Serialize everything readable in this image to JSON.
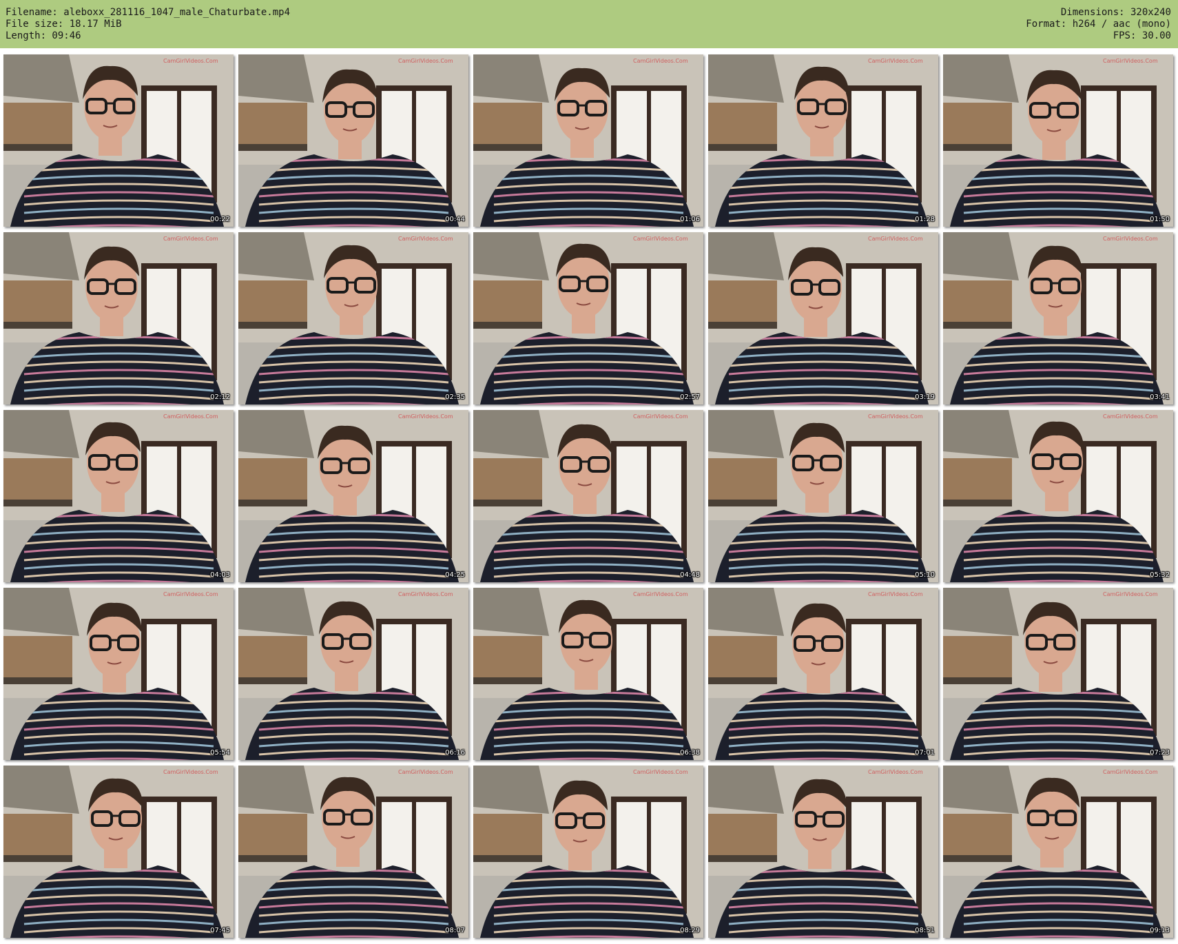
{
  "header": {
    "filename": "Filename: aleboxx_281116_1047_male_Chaturbate.mp4",
    "filesize": "File size: 18.17 MiB",
    "length": "Length: 09:46",
    "dimensions": "Dimensions: 320x240",
    "format": "Format: h264 / aac (mono)",
    "fps": "FPS: 30.00"
  },
  "thumbnails": [
    {
      "time": "00:22"
    },
    {
      "time": "00:44"
    },
    {
      "time": "01:06"
    },
    {
      "time": "01:28"
    },
    {
      "time": "01:50"
    },
    {
      "time": "02:12"
    },
    {
      "time": "02:35"
    },
    {
      "time": "02:57"
    },
    {
      "time": "03:19"
    },
    {
      "time": "03:41"
    },
    {
      "time": "04:03"
    },
    {
      "time": "04:25"
    },
    {
      "time": "04:48"
    },
    {
      "time": "05:10"
    },
    {
      "time": "05:32"
    },
    {
      "time": "05:54"
    },
    {
      "time": "06:16"
    },
    {
      "time": "06:38"
    },
    {
      "time": "07:01"
    },
    {
      "time": "07:23"
    },
    {
      "time": "07:45"
    },
    {
      "time": "08:07"
    },
    {
      "time": "08:29"
    },
    {
      "time": "08:51"
    },
    {
      "time": "09:13"
    }
  ],
  "colors": {
    "header_bg": "#aecb80",
    "wall": "#c9c3b8",
    "window": "#f3f1ec",
    "cabinet": "#9a7a5a",
    "shirt_dark": "#1c1f2b",
    "stripe_pink": "#c77a9a",
    "stripe_beige": "#d8c3a8",
    "stripe_blue": "#8fb0c4",
    "skin": "#d9a890",
    "hair": "#3a2a20"
  }
}
